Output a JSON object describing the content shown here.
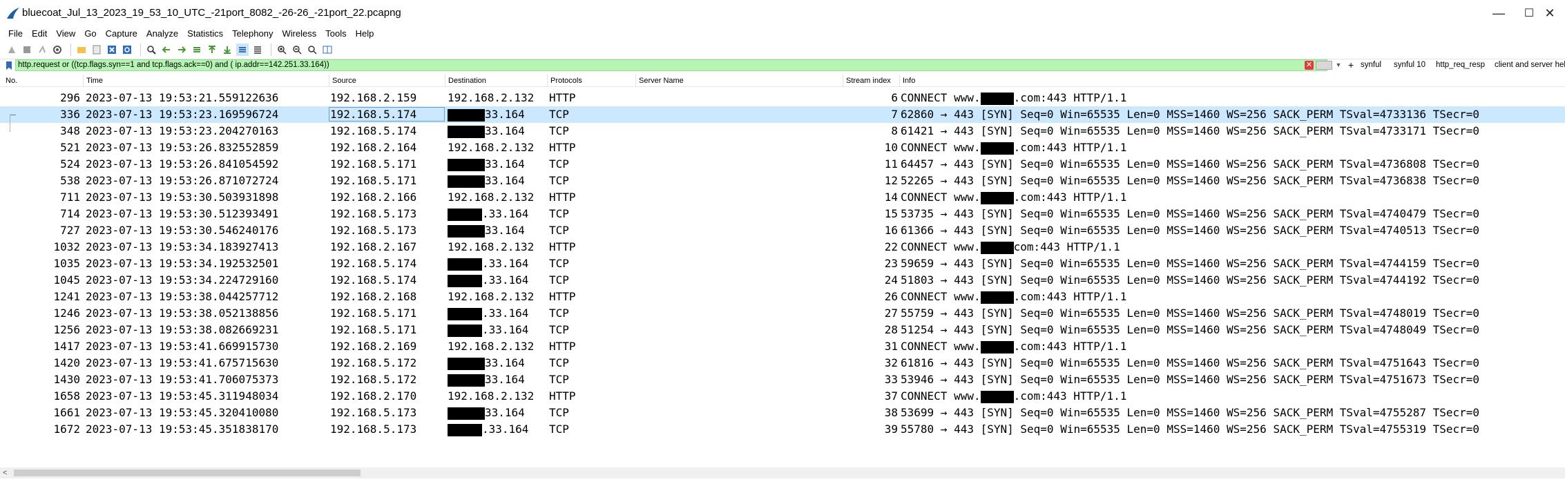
{
  "window": {
    "title": "bluecoat_Jul_13_2023_19_53_10_UTC_-21port_8082_-26-26_-21port_22.pcapng",
    "minimize": "—",
    "maximize": "☐",
    "close": "✕"
  },
  "menu": [
    "File",
    "Edit",
    "View",
    "Go",
    "Capture",
    "Analyze",
    "Statistics",
    "Telephony",
    "Wireless",
    "Tools",
    "Help"
  ],
  "filter": {
    "value": "http.request or ((tcp.flags.syn==1 and tcp.flags.ack==0) and ( ip.addr==142.251.33.164))",
    "buttons": [
      "synful",
      "synful 10",
      "http_req_resp",
      "client and server hello"
    ],
    "bg_color": "#b6f5b4"
  },
  "columns": {
    "no": "No.",
    "time": "Time",
    "source": "Source",
    "destination": "Destination",
    "protocol": "Protocols",
    "server_name": "Server Name",
    "stream": "Stream index",
    "info": "Info"
  },
  "packets": [
    {
      "no": "296",
      "time": "2023-07-13 19:53:21.559122636",
      "src": "192.168.2.159",
      "dst": "192.168.2.132",
      "dst_suffix": "",
      "proto": "HTTP",
      "stream": "6",
      "info_pre": "CONNECT www.",
      "info_post": ".com:443 HTTP/1.1"
    },
    {
      "no": "336",
      "time": "2023-07-13 19:53:23.169596724",
      "src": "192.168.5.174",
      "dst": "",
      "dst_suffix": "33.164",
      "proto": "TCP",
      "stream": "7",
      "info_pre": "",
      "info_post": "62860 → 443 [SYN] Seq=0 Win=65535 Len=0 MSS=1460 WS=256 SACK_PERM TSval=4733136 TSecr=0"
    },
    {
      "no": "348",
      "time": "2023-07-13 19:53:23.204270163",
      "src": "192.168.5.174",
      "dst": "",
      "dst_suffix": "33.164",
      "proto": "TCP",
      "stream": "8",
      "info_pre": "",
      "info_post": "61421 → 443 [SYN] Seq=0 Win=65535 Len=0 MSS=1460 WS=256 SACK_PERM TSval=4733171 TSecr=0"
    },
    {
      "no": "521",
      "time": "2023-07-13 19:53:26.832552859",
      "src": "192.168.2.164",
      "dst": "192.168.2.132",
      "dst_suffix": "",
      "proto": "HTTP",
      "stream": "10",
      "info_pre": "CONNECT www.",
      "info_post": ".com:443 HTTP/1.1"
    },
    {
      "no": "524",
      "time": "2023-07-13 19:53:26.841054592",
      "src": "192.168.5.171",
      "dst": "",
      "dst_suffix": "33.164",
      "proto": "TCP",
      "stream": "11",
      "info_pre": "",
      "info_post": "64457 → 443 [SYN] Seq=0 Win=65535 Len=0 MSS=1460 WS=256 SACK_PERM TSval=4736808 TSecr=0"
    },
    {
      "no": "538",
      "time": "2023-07-13 19:53:26.871072724",
      "src": "192.168.5.171",
      "dst": "",
      "dst_suffix": "33.164",
      "proto": "TCP",
      "stream": "12",
      "info_pre": "",
      "info_post": "52265 → 443 [SYN] Seq=0 Win=65535 Len=0 MSS=1460 WS=256 SACK_PERM TSval=4736838 TSecr=0"
    },
    {
      "no": "711",
      "time": "2023-07-13 19:53:30.503931898",
      "src": "192.168.2.166",
      "dst": "192.168.2.132",
      "dst_suffix": "",
      "proto": "HTTP",
      "stream": "14",
      "info_pre": "CONNECT www.",
      "info_post": ".com:443 HTTP/1.1"
    },
    {
      "no": "714",
      "time": "2023-07-13 19:53:30.512393491",
      "src": "192.168.5.173",
      "dst": "",
      "dst_suffix": ".33.164",
      "proto": "TCP",
      "stream": "15",
      "info_pre": "",
      "info_post": "53735 → 443 [SYN] Seq=0 Win=65535 Len=0 MSS=1460 WS=256 SACK_PERM TSval=4740479 TSecr=0"
    },
    {
      "no": "727",
      "time": "2023-07-13 19:53:30.546240176",
      "src": "192.168.5.173",
      "dst": "",
      "dst_suffix": "33.164",
      "proto": "TCP",
      "stream": "16",
      "info_pre": "",
      "info_post": "61366 → 443 [SYN] Seq=0 Win=65535 Len=0 MSS=1460 WS=256 SACK_PERM TSval=4740513 TSecr=0"
    },
    {
      "no": "1032",
      "time": "2023-07-13 19:53:34.183927413",
      "src": "192.168.2.167",
      "dst": "192.168.2.132",
      "dst_suffix": "",
      "proto": "HTTP",
      "stream": "22",
      "info_pre": "CONNECT www.",
      "info_post": "com:443 HTTP/1.1"
    },
    {
      "no": "1035",
      "time": "2023-07-13 19:53:34.192532501",
      "src": "192.168.5.174",
      "dst": "",
      "dst_suffix": ".33.164",
      "proto": "TCP",
      "stream": "23",
      "info_pre": "",
      "info_post": "59659 → 443 [SYN] Seq=0 Win=65535 Len=0 MSS=1460 WS=256 SACK_PERM TSval=4744159 TSecr=0"
    },
    {
      "no": "1045",
      "time": "2023-07-13 19:53:34.224729160",
      "src": "192.168.5.174",
      "dst": "",
      "dst_suffix": ".33.164",
      "proto": "TCP",
      "stream": "24",
      "info_pre": "",
      "info_post": "51803 → 443 [SYN] Seq=0 Win=65535 Len=0 MSS=1460 WS=256 SACK_PERM TSval=4744192 TSecr=0"
    },
    {
      "no": "1241",
      "time": "2023-07-13 19:53:38.044257712",
      "src": "192.168.2.168",
      "dst": "192.168.2.132",
      "dst_suffix": "",
      "proto": "HTTP",
      "stream": "26",
      "info_pre": "CONNECT www.",
      "info_post": ".com:443 HTTP/1.1"
    },
    {
      "no": "1246",
      "time": "2023-07-13 19:53:38.052138856",
      "src": "192.168.5.171",
      "dst": "",
      "dst_suffix": ".33.164",
      "proto": "TCP",
      "stream": "27",
      "info_pre": "",
      "info_post": "55759 → 443 [SYN] Seq=0 Win=65535 Len=0 MSS=1460 WS=256 SACK_PERM TSval=4748019 TSecr=0"
    },
    {
      "no": "1256",
      "time": "2023-07-13 19:53:38.082669231",
      "src": "192.168.5.171",
      "dst": "",
      "dst_suffix": ".33.164",
      "proto": "TCP",
      "stream": "28",
      "info_pre": "",
      "info_post": "51254 → 443 [SYN] Seq=0 Win=65535 Len=0 MSS=1460 WS=256 SACK_PERM TSval=4748049 TSecr=0"
    },
    {
      "no": "1417",
      "time": "2023-07-13 19:53:41.669915730",
      "src": "192.168.2.169",
      "dst": "192.168.2.132",
      "dst_suffix": "",
      "proto": "HTTP",
      "stream": "31",
      "info_pre": "CONNECT www.",
      "info_post": ".com:443 HTTP/1.1"
    },
    {
      "no": "1420",
      "time": "2023-07-13 19:53:41.675715630",
      "src": "192.168.5.172",
      "dst": "",
      "dst_suffix": "33.164",
      "proto": "TCP",
      "stream": "32",
      "info_pre": "",
      "info_post": "61816 → 443 [SYN] Seq=0 Win=65535 Len=0 MSS=1460 WS=256 SACK_PERM TSval=4751643 TSecr=0"
    },
    {
      "no": "1430",
      "time": "2023-07-13 19:53:41.706075373",
      "src": "192.168.5.172",
      "dst": "",
      "dst_suffix": "33.164",
      "proto": "TCP",
      "stream": "33",
      "info_pre": "",
      "info_post": "53946 → 443 [SYN] Seq=0 Win=65535 Len=0 MSS=1460 WS=256 SACK_PERM TSval=4751673 TSecr=0"
    },
    {
      "no": "1658",
      "time": "2023-07-13 19:53:45.311948034",
      "src": "192.168.2.170",
      "dst": "192.168.2.132",
      "dst_suffix": "",
      "proto": "HTTP",
      "stream": "37",
      "info_pre": "CONNECT www.",
      "info_post": ".com:443 HTTP/1.1"
    },
    {
      "no": "1661",
      "time": "2023-07-13 19:53:45.320410080",
      "src": "192.168.5.173",
      "dst": "",
      "dst_suffix": "33.164",
      "proto": "TCP",
      "stream": "38",
      "info_pre": "",
      "info_post": "53699 → 443 [SYN] Seq=0 Win=65535 Len=0 MSS=1460 WS=256 SACK_PERM TSval=4755287 TSecr=0"
    },
    {
      "no": "1672",
      "time": "2023-07-13 19:53:45.351838170",
      "src": "192.168.5.173",
      "dst": "",
      "dst_suffix": ".33.164",
      "proto": "TCP",
      "stream": "39",
      "info_pre": "",
      "info_post": "55780 → 443 [SYN] Seq=0 Win=65535 Len=0 MSS=1460 WS=256 SACK_PERM TSval=4755319 TSecr=0"
    }
  ],
  "selected_row": "336",
  "colors": {
    "selected": "#cce8ff",
    "filter_valid": "#b6f5b4",
    "title_icon": "#1f5fa8"
  }
}
